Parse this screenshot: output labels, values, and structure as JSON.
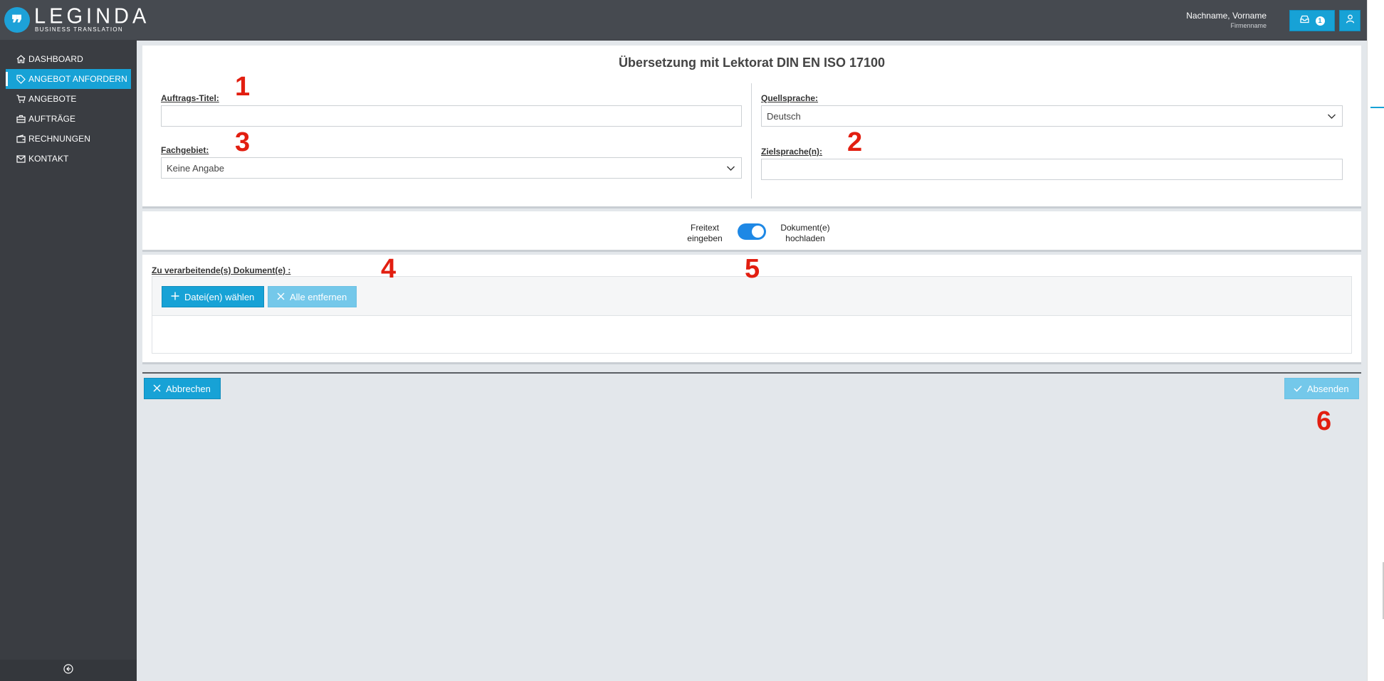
{
  "brand": {
    "logo_mark": "❞",
    "name": "LEGINDA",
    "tagline": "BUSINESS TRANSLATION"
  },
  "header": {
    "user_name": "Nachname, Vorname",
    "company": "Firmenname",
    "message_count": "1",
    "icons": [
      "inbox-icon",
      "user-icon"
    ]
  },
  "sidebar": {
    "items": [
      {
        "label": "DASHBOARD",
        "icon": "home-icon",
        "active": false
      },
      {
        "label": "ANGEBOT ANFORDERN",
        "icon": "tag-icon",
        "active": true
      },
      {
        "label": "ANGEBOTE",
        "icon": "cart-icon",
        "active": false
      },
      {
        "label": "AUFTRÄGE",
        "icon": "briefcase-icon",
        "active": false
      },
      {
        "label": "RECHNUNGEN",
        "icon": "wallet-icon",
        "active": false
      },
      {
        "label": "KONTAKT",
        "icon": "mail-icon",
        "active": false
      }
    ],
    "collapse_icon": "collapse-left-icon"
  },
  "form": {
    "title": "Übersetzung mit Lektorat DIN EN ISO 17100",
    "order_title_label": "Auftrags-Titel:",
    "order_title_value": "",
    "subject_label": "Fachgebiet:",
    "subject_value": "Keine Angabe",
    "source_lang_label": "Quellsprache:",
    "source_lang_value": "Deutsch",
    "target_lang_label": "Zielsprache(n):",
    "target_lang_value": ""
  },
  "mode_toggle": {
    "left_label_1": "Freitext",
    "left_label_2": "eingeben",
    "right_label_1": "Dokument(e)",
    "right_label_2": "hochladen",
    "state": "Dokument(e) hochladen"
  },
  "upload": {
    "label": "Zu verarbeitende(s) Dokument(e) :",
    "choose_button": "Datei(en) wählen",
    "remove_all_button": "Alle entfernen"
  },
  "actions": {
    "cancel": "Abbrechen",
    "submit": "Absenden"
  },
  "annotations": [
    "1",
    "2",
    "3",
    "4",
    "5",
    "6"
  ],
  "colors": {
    "accent": "#17a2d6",
    "header_bg": "#464a50",
    "sidebar_bg": "#3a3d42",
    "annotation": "#e21e10",
    "toggle": "#1e88e5"
  }
}
